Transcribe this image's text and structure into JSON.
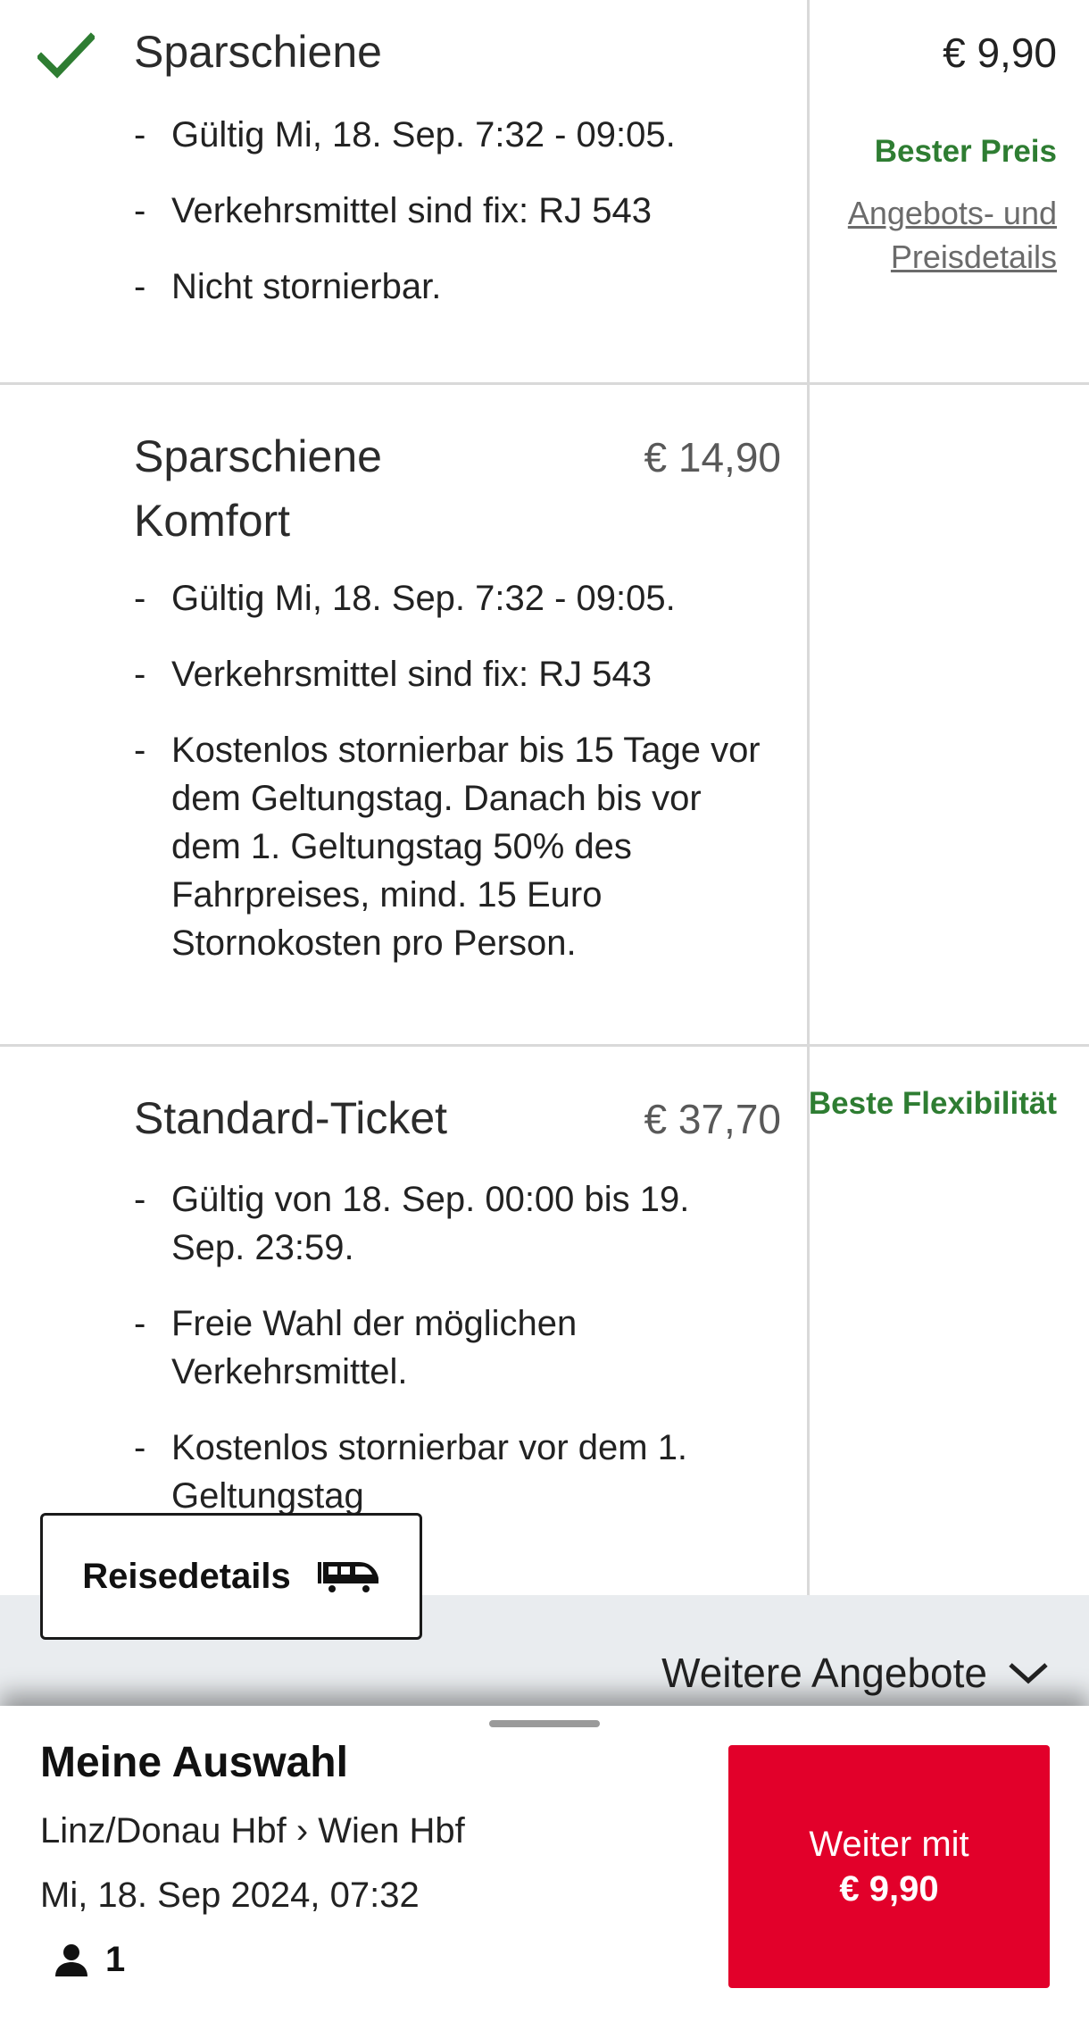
{
  "offers": [
    {
      "title": "Sparschiene",
      "price": "€ 9,90",
      "selected": true,
      "tag": "Bester Preis",
      "details_link": "Angebots- und Preisdetails",
      "bullets": [
        "Gültig Mi, 18. Sep. 7:32 - 09:05.",
        "Verkehrsmittel sind fix: RJ 543",
        "Nicht stornierbar."
      ]
    },
    {
      "title": "Sparschiene Komfort",
      "price": "€ 14,90",
      "selected": false,
      "bullets": [
        "Gültig Mi, 18. Sep. 7:32 - 09:05.",
        "Verkehrsmittel sind fix: RJ 543",
        "Kostenlos stornierbar bis 15 Tage vor dem Geltungstag. Danach bis vor dem 1. Geltungstag 50% des Fahrpreises, mind. 15 Euro Stornokosten pro Person."
      ]
    },
    {
      "title": "Standard-Ticket",
      "price": "€ 37,70",
      "selected": false,
      "tag": "Beste Flexibilität",
      "bullets": [
        "Gültig von 18. Sep. 00:00 bis 19. Sep. 23:59.",
        "Freie Wahl der möglichen Verkehrsmittel.",
        "Kostenlos stornierbar vor dem 1. Geltungstag"
      ]
    }
  ],
  "bullet_marker": "-",
  "reisedetails_label": "Reisedetails",
  "weitere_angebote_label": "Weitere Angebote",
  "selection": {
    "title": "Meine Auswahl",
    "route": "Linz/Donau Hbf › Wien Hbf",
    "datetime": "Mi, 18. Sep 2024, 07:32",
    "passengers": "1",
    "cta_line1": "Weiter mit",
    "cta_amount": "€ 9,90"
  },
  "colors": {
    "accent_green": "#2e7d32",
    "cta_red": "#e2002a"
  },
  "icons": [
    "check-icon",
    "train-icon",
    "chevron-down-icon",
    "person-icon"
  ]
}
